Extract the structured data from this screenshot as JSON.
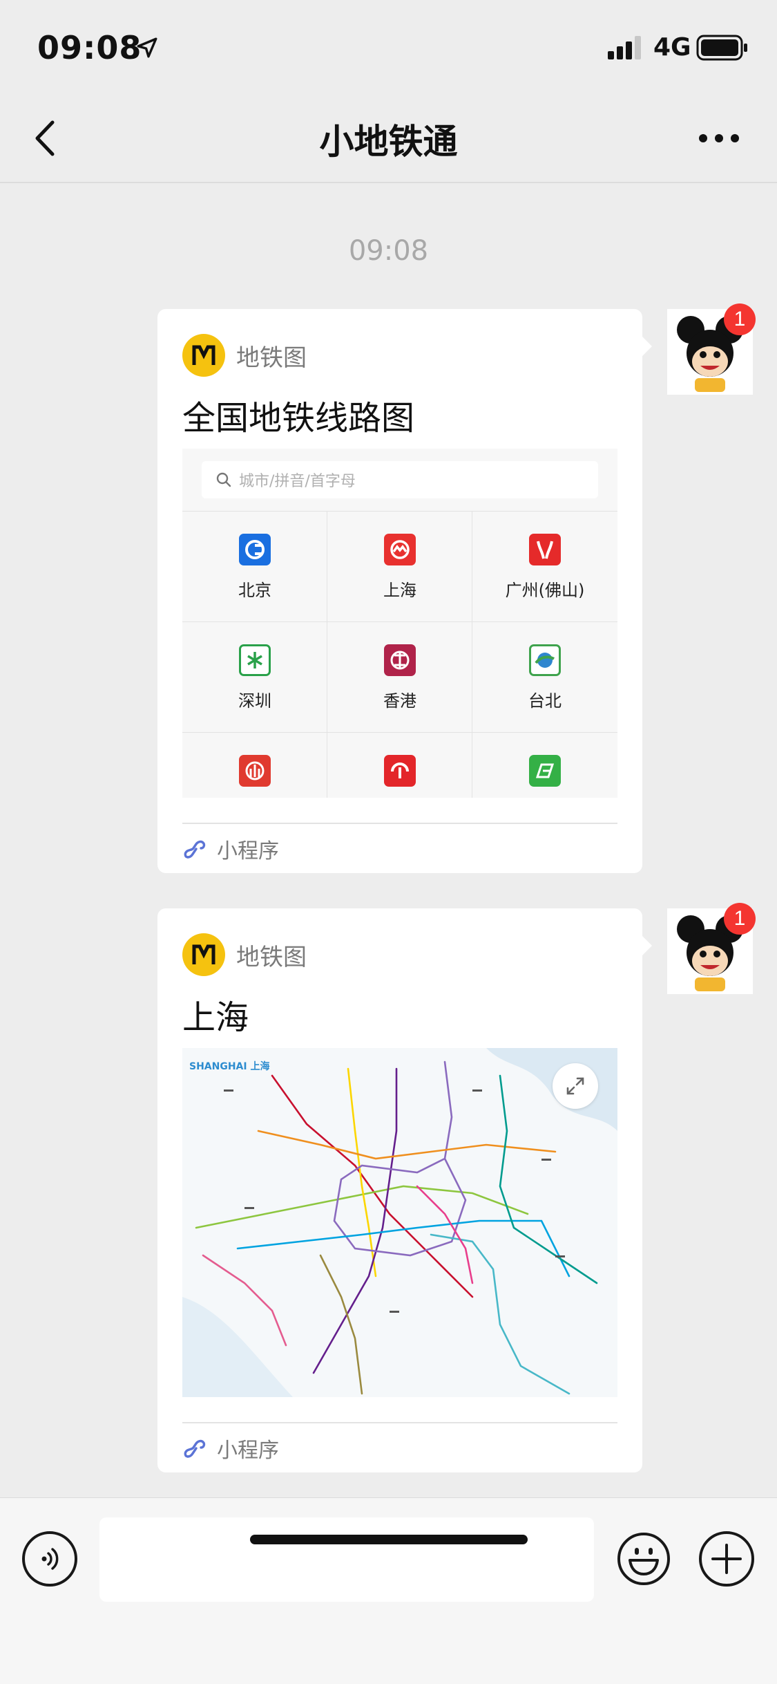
{
  "status_bar": {
    "time": "09:08",
    "network": "4G",
    "icons": [
      "location-arrow-icon",
      "signal-icon",
      "battery-icon"
    ]
  },
  "nav": {
    "title": "小地铁通",
    "back_icon": "chevron-left-icon",
    "more_icon": "more-dots-icon"
  },
  "chat": {
    "timestamp": "09:08",
    "messages": [
      {
        "source_name": "地铁图",
        "title": "全国地铁线路图",
        "footer_label": "小程序",
        "avatar_badge": "1",
        "search_placeholder": "城市/拼音/首字母",
        "cities": [
          {
            "label": "北京",
            "color": "#1a6fe0"
          },
          {
            "label": "上海",
            "color": "#e8312f"
          },
          {
            "label": "广州(佛山)",
            "color": "#e52a2a"
          },
          {
            "label": "深圳",
            "color": "#2aa14a"
          },
          {
            "label": "香港",
            "color": "#b0234a"
          },
          {
            "label": "台北",
            "color": "#3fa34d"
          },
          {
            "label": "",
            "color": "#e03a2f"
          },
          {
            "label": "",
            "color": "#e3262a"
          },
          {
            "label": "",
            "color": "#34b046"
          }
        ]
      },
      {
        "source_name": "地铁图",
        "title": "上海",
        "footer_label": "小程序",
        "avatar_badge": "1",
        "map_label": "SHANGHAI 上海"
      }
    ]
  },
  "input_bar": {
    "icons": [
      "voice-icon",
      "emoji-icon",
      "plus-icon"
    ]
  },
  "colors": {
    "background": "#ededed",
    "badge": "#f43530",
    "brand_logo": "#f5c20f"
  }
}
